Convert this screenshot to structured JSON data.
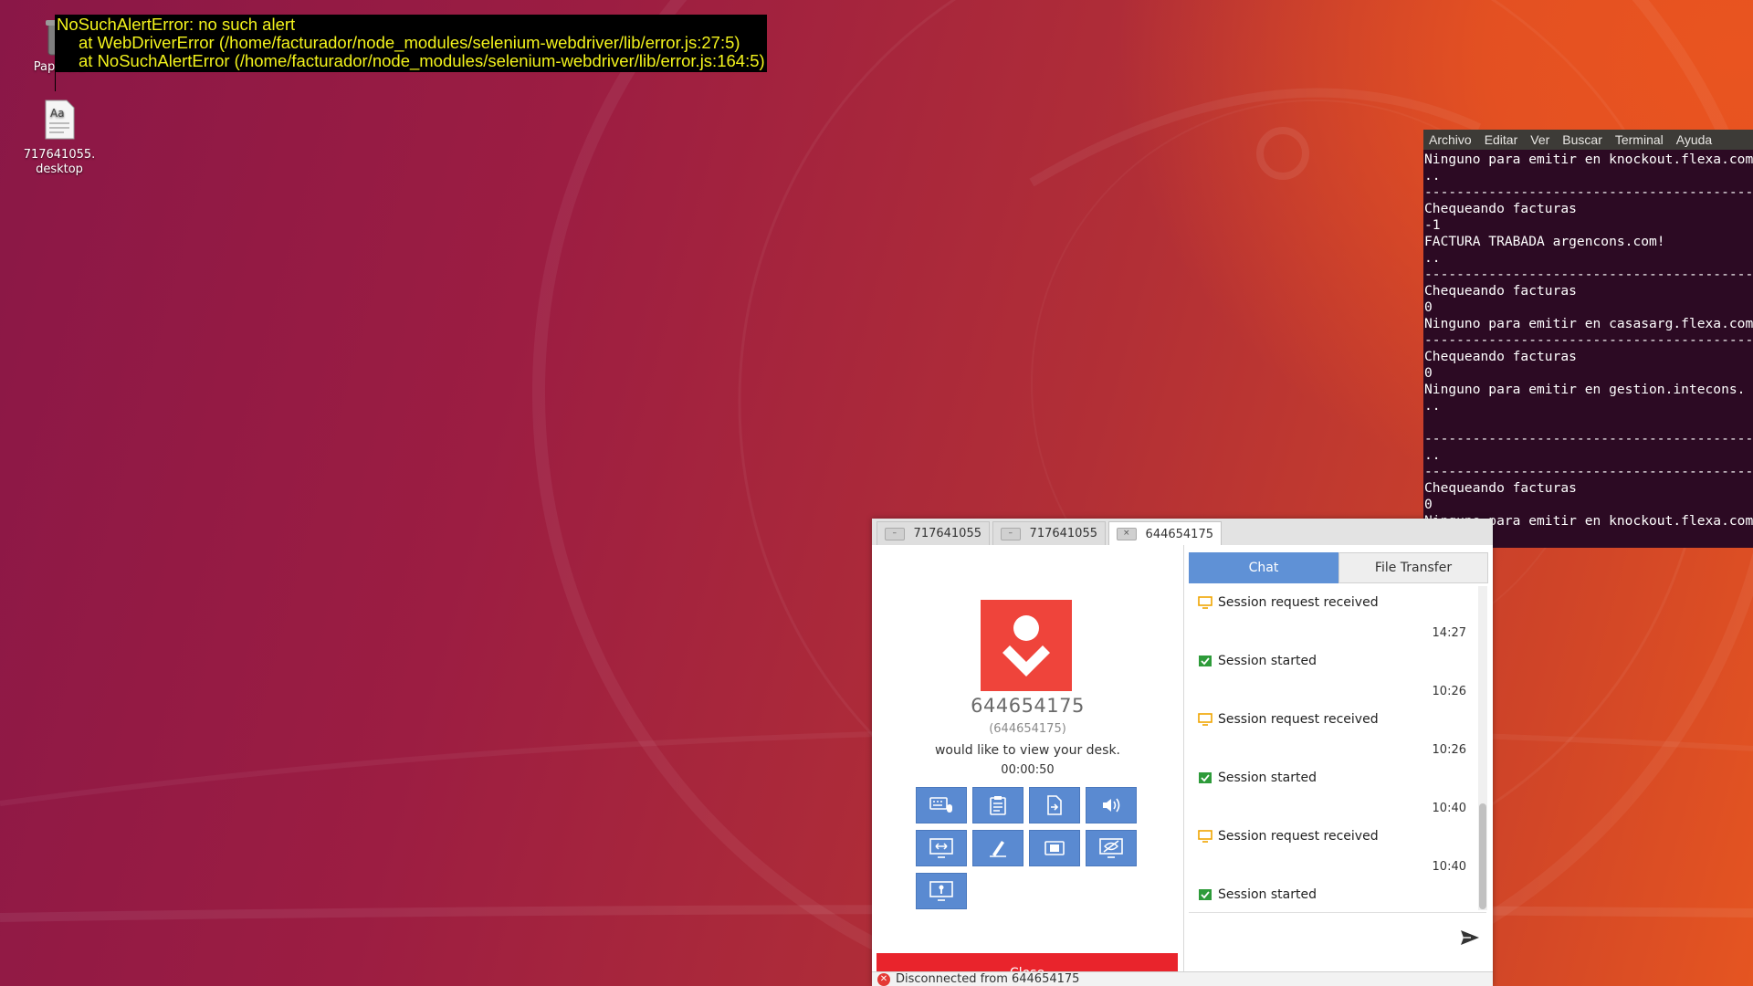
{
  "error_overlay": {
    "lines": [
      "NoSuchAlertError: no such alert",
      "at WebDriverError (/home/facturador/node_modules/selenium-webdriver/lib/error.js:27:5)",
      "at NoSuchAlertError (/home/facturador/node_modules/selenium-webdriver/lib/error.js:164:5)"
    ]
  },
  "desktop": {
    "icons": [
      {
        "label": "Papelera",
        "icon": "trash-icon"
      },
      {
        "label": "717641055.\ndesktop",
        "icon": "text-file-icon"
      }
    ]
  },
  "terminal": {
    "menu": [
      "Archivo",
      "Editar",
      "Ver",
      "Buscar",
      "Terminal",
      "Ayuda"
    ],
    "lines": [
      "Ninguno para emitir en knockout.flexa.com",
      "..",
      "------------------------------------------------",
      "Chequeando facturas",
      "-1",
      "FACTURA TRABADA argencons.com!",
      "..",
      "------------------------------------------------",
      "Chequeando facturas",
      "0",
      "Ninguno para emitir en casasarg.flexa.com",
      "------------------------------------------------",
      "Chequeando facturas",
      "0",
      "Ninguno para emitir en gestion.intecons.",
      "..",
      "",
      "------------------------------------------------",
      "..",
      "------------------------------------------------",
      "Chequeando facturas",
      "0",
      "Ninguno para emitir en knockout.flexa.com"
    ]
  },
  "anydesk": {
    "tabs": [
      {
        "label": "717641055",
        "active": false
      },
      {
        "label": "717641055",
        "active": false
      },
      {
        "label": "644654175",
        "active": true
      }
    ],
    "caller": {
      "id": "644654175",
      "sub_id": "(644654175)",
      "message": "would like to view your desk.",
      "timer": "00:00:50"
    },
    "permissions": [
      {
        "icon": "keyboard-mouse-icon"
      },
      {
        "icon": "clipboard-icon"
      },
      {
        "icon": "file-transfer-icon"
      },
      {
        "icon": "sound-icon"
      },
      {
        "icon": "control-switch-icon"
      },
      {
        "icon": "draw-icon"
      },
      {
        "icon": "record-icon"
      },
      {
        "icon": "privacy-mode-icon"
      },
      {
        "icon": "lock-desktop-icon"
      }
    ],
    "close_label": "Close",
    "right_tabs": {
      "chat": "Chat",
      "file_transfer": "File Transfer"
    },
    "chat": [
      {
        "type": "request",
        "text": "Session request received",
        "time": "14:27"
      },
      {
        "type": "started",
        "text": "Session started",
        "time": "10:26"
      },
      {
        "type": "request",
        "text": "Session request received",
        "time": "10:26"
      },
      {
        "type": "started",
        "text": "Session started",
        "time": "10:40"
      },
      {
        "type": "request",
        "text": "Session request received",
        "time": "10:40"
      },
      {
        "type": "started",
        "text": "Session started",
        "time": ""
      }
    ],
    "status": "Disconnected from 644654175"
  },
  "colors": {
    "anydesk_red": "#ef443b",
    "close_red": "#e9242c",
    "permission_blue": "#5a8ad1",
    "chat_tab_blue": "#5f91d6",
    "error_text": "#f3f31c",
    "terminal_bg": "#2c0a23",
    "request_icon": "#f0a500",
    "started_icon": "#2e9b3a"
  }
}
